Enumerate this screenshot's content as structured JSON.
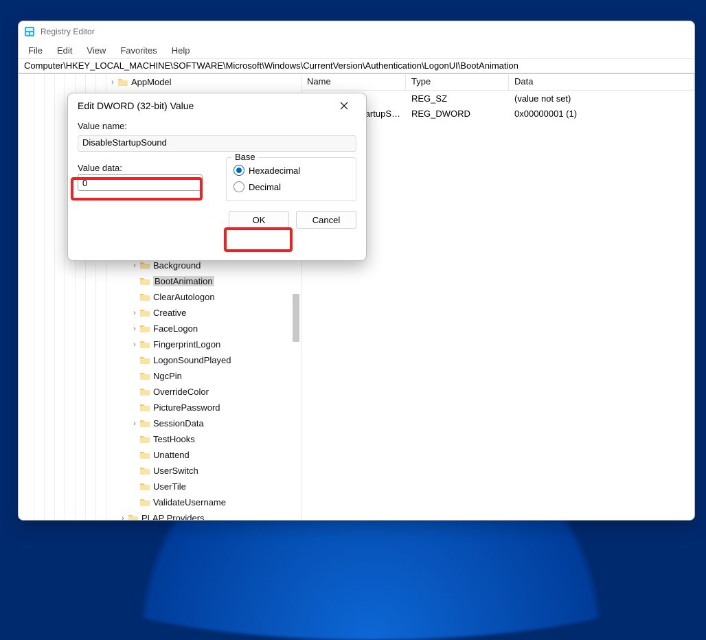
{
  "window": {
    "title": "Registry Editor",
    "menu": [
      "File",
      "Edit",
      "View",
      "Favorites",
      "Help"
    ],
    "address": "Computer\\HKEY_LOCAL_MACHINE\\SOFTWARE\\Microsoft\\Windows\\CurrentVersion\\Authentication\\LogonUI\\BootAnimation"
  },
  "list": {
    "headers": {
      "name": "Name",
      "type": "Type",
      "data": "Data"
    },
    "rows": [
      {
        "name": "",
        "type": "REG_SZ",
        "data": "(value not set)"
      },
      {
        "name_suffix": "tartupS…",
        "type": "REG_DWORD",
        "data": "0x00000001 (1)"
      }
    ]
  },
  "tree": {
    "top": {
      "label": "AppModel",
      "has_caret": true
    },
    "items": [
      {
        "label": "Background",
        "caret": true,
        "sel": false
      },
      {
        "label": "BootAnimation",
        "caret": false,
        "sel": true
      },
      {
        "label": "ClearAutologon",
        "caret": false,
        "sel": false
      },
      {
        "label": "Creative",
        "caret": true,
        "sel": false
      },
      {
        "label": "FaceLogon",
        "caret": true,
        "sel": false
      },
      {
        "label": "FingerprintLogon",
        "caret": true,
        "sel": false
      },
      {
        "label": "LogonSoundPlayed",
        "caret": false,
        "sel": false
      },
      {
        "label": "NgcPin",
        "caret": false,
        "sel": false
      },
      {
        "label": "OverrideColor",
        "caret": false,
        "sel": false
      },
      {
        "label": "PicturePassword",
        "caret": false,
        "sel": false
      },
      {
        "label": "SessionData",
        "caret": true,
        "sel": false
      },
      {
        "label": "TestHooks",
        "caret": false,
        "sel": false
      },
      {
        "label": "Unattend",
        "caret": false,
        "sel": false
      },
      {
        "label": "UserSwitch",
        "caret": false,
        "sel": false
      },
      {
        "label": "UserTile",
        "caret": false,
        "sel": false
      },
      {
        "label": "ValidateUsername",
        "caret": false,
        "sel": false
      }
    ],
    "bottom": {
      "label": "PLAP Providers",
      "caret": true
    }
  },
  "dialog": {
    "title": "Edit DWORD (32-bit) Value",
    "value_name_label": "Value name:",
    "value_name": "DisableStartupSound",
    "value_data_label": "Value data:",
    "value_data": "0",
    "base_label": "Base",
    "hex_label": "Hexadecimal",
    "dec_label": "Decimal",
    "ok": "OK",
    "cancel": "Cancel"
  }
}
